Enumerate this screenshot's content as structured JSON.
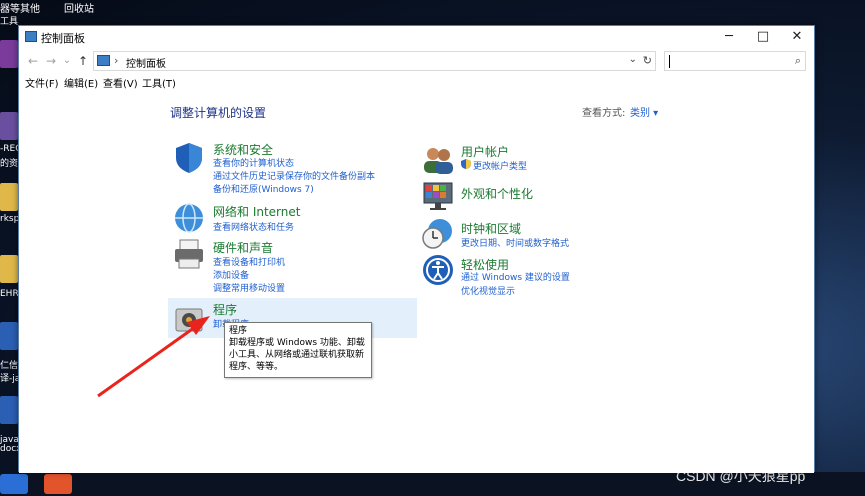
{
  "desktop": {
    "top_labels": [
      "器等其他",
      "回收站"
    ],
    "side_labels": [
      "工具",
      "-REC",
      "的资源",
      "rksp",
      "EHR",
      "仁信息",
      "译-java",
      "java快",
      "docx"
    ]
  },
  "window": {
    "title": "控制面板",
    "controls": {
      "minimize": "─",
      "maximize": "□",
      "close": "✕"
    }
  },
  "address": {
    "path": "控制面板",
    "separator": "›",
    "dropdown": "⌄",
    "refresh": "↻",
    "search_icon": "⌕"
  },
  "nav": {
    "back": "←",
    "forward": "→",
    "recent": "⌄",
    "up": "↑"
  },
  "menu": [
    "文件(F)",
    "编辑(E)",
    "查看(V)",
    "工具(T)"
  ],
  "page": {
    "title": "调整计算机的设置",
    "view_by_label": "查看方式:",
    "view_by_value": "类别 ▾"
  },
  "categories_left": [
    {
      "title": "系统和安全",
      "links": [
        "查看你的计算机状态",
        "通过文件历史记录保存你的文件备份副本",
        "备份和还原(Windows 7)"
      ]
    },
    {
      "title": "网络和 Internet",
      "links": [
        "查看网络状态和任务"
      ]
    },
    {
      "title": "硬件和声音",
      "links": [
        "查看设备和打印机",
        "添加设备",
        "调整常用移动设置"
      ]
    },
    {
      "title": "程序",
      "links": [
        "卸载程序"
      ]
    }
  ],
  "categories_right": [
    {
      "title": "用户帐户",
      "links": [
        "更改帐户类型"
      ]
    },
    {
      "title": "外观和个性化",
      "links": []
    },
    {
      "title": "时钟和区域",
      "links": [
        "更改日期、时间或数字格式"
      ]
    },
    {
      "title": "轻松使用",
      "links": [
        "通过 Windows 建议的设置",
        "优化视觉显示"
      ]
    }
  ],
  "tooltip": {
    "title": "程序",
    "body": "卸载程序或 Windows 功能、卸载小工具、从网络或通过联机获取新程序、等等。"
  },
  "watermark": "CSDN @小天狼星pp",
  "colors": {
    "category_title": "#1a7a30",
    "link": "#1f5fd0",
    "page_title": "#1e3287",
    "hover_band": "#e3f0fb",
    "annotation_arrow": "#e8241c"
  }
}
